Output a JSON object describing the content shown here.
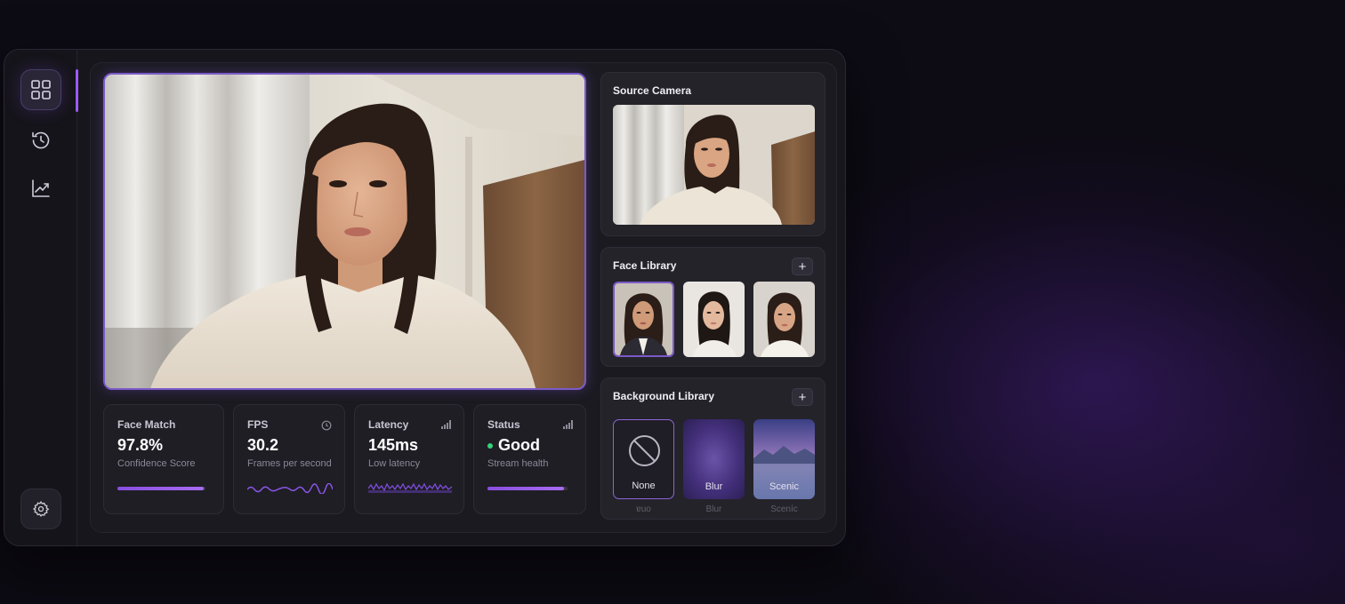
{
  "nav": {
    "items": [
      {
        "icon": "dashboard-grid-icon",
        "active": true
      },
      {
        "icon": "history-clock-icon",
        "active": false
      },
      {
        "icon": "analytics-chart-icon",
        "active": false
      }
    ],
    "settings_icon": "gear-icon"
  },
  "stats": [
    {
      "label": "Face Match",
      "value": "97.8%",
      "sub": "Confidence Score",
      "progress": 0.98,
      "corner_icon": ""
    },
    {
      "label": "FPS",
      "value": "30.2",
      "sub": "Frames per second",
      "corner_icon": "clock-icon"
    },
    {
      "label": "Latency",
      "value": "145ms",
      "sub": "Low latency",
      "corner_icon": "signal-bars-icon"
    },
    {
      "label": "Status",
      "value": "Good",
      "sub": "Stream health",
      "progress": 0.95,
      "corner_icon": "signal-bars-icon",
      "status_color": "#34d37a"
    }
  ],
  "source_camera": {
    "title": "Source Camera"
  },
  "face_library": {
    "title": "Face Library",
    "add_label": "+",
    "faces_count_visible": 3,
    "selected_index": 0
  },
  "background_library": {
    "title": "Background Library",
    "add_label": "+",
    "options": [
      {
        "name": "None",
        "ghost": "ɐuo",
        "selected": true
      },
      {
        "name": "Blur",
        "ghost": "Blur",
        "selected": false
      },
      {
        "name": "Scenic",
        "ghost": "Sceníc",
        "selected": false
      }
    ]
  },
  "colors": {
    "accent": "#9b5cf0",
    "status_good": "#34d37a",
    "panel": "#1b1a21"
  }
}
